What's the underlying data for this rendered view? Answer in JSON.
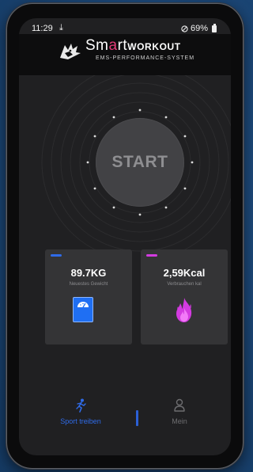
{
  "status": {
    "time": "11:29",
    "download_glyph": "⤓",
    "battery_percent": "69%"
  },
  "brand": {
    "name_prefix": "Sm",
    "name_accent": "a",
    "name_mid": "rt",
    "name_suffix": "WORKOUT",
    "subtitle": "EMS-PERFORMANCE-SYSTEM",
    "accent_color": "#e23c78"
  },
  "start": {
    "label": "START"
  },
  "cards": {
    "weight": {
      "value": "89.7KG",
      "label": "Neuestes Gewicht",
      "accent_color": "#2f6be8",
      "icon": "scale-icon"
    },
    "calories": {
      "value": "2,59Kcal",
      "label": "Verbrauchen kal",
      "accent_color": "#d33be0",
      "icon": "flame-icon"
    }
  },
  "nav": {
    "sport_label": "Sport treiben",
    "mein_label": "Mein",
    "active_color": "#2f6be8",
    "inactive_color": "#6d6d70"
  }
}
